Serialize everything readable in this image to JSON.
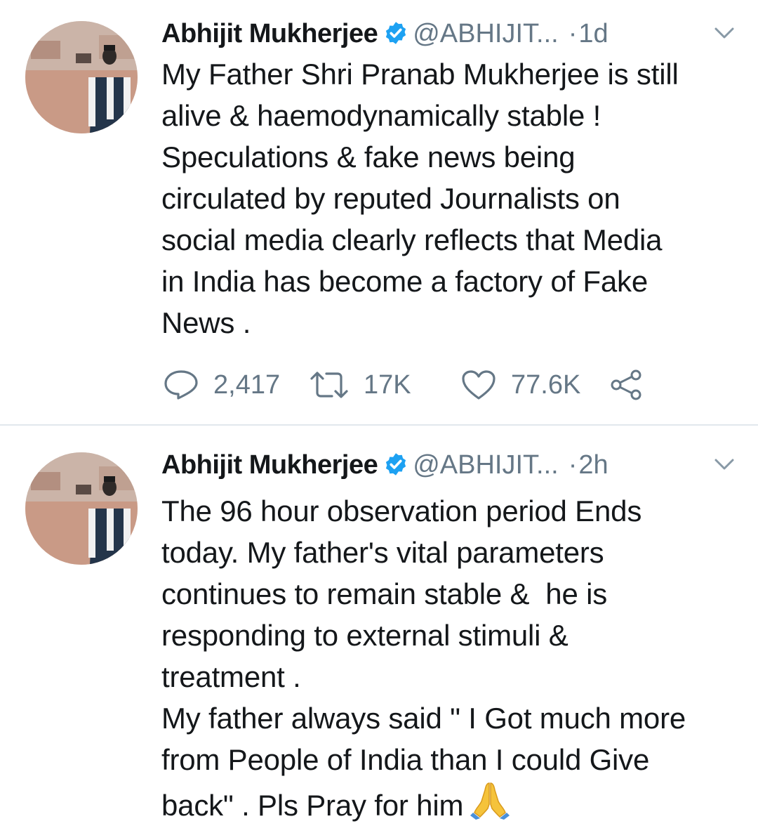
{
  "tweets": [
    {
      "author": {
        "display_name": "Abhijit Mukherjee",
        "handle": "@ABHIJIT...",
        "verified": true
      },
      "time": "1d",
      "text": "My Father Shri Pranab Mukherjee is still\nalive & haemodynamically stable !\nSpeculations & fake news being\ncirculated by reputed Journalists on\nsocial media clearly reflects that Media\nin India has become a factory of Fake\nNews .",
      "stats": {
        "replies": "2,417",
        "retweets": "17K",
        "likes": "77.6K"
      }
    },
    {
      "author": {
        "display_name": "Abhijit Mukherjee",
        "handle": "@ABHIJIT...",
        "verified": true
      },
      "time": "2h",
      "text": "The 96 hour observation period Ends\ntoday. My father's vital parameters\ncontinues to remain stable &  he is\nresponding to external stimuli &\ntreatment .\nMy father always said \" I Got much more\nfrom People of India than I could Give\nback\" . Pls Pray for him",
      "emoji": "folded-hands-emoji"
    }
  ],
  "separator": "·",
  "icons": {
    "verified": "verified-badge-icon",
    "menu": "chevron-down-icon",
    "reply": "reply-icon",
    "retweet": "retweet-icon",
    "like": "heart-icon",
    "share": "share-icon"
  },
  "colors": {
    "text": "#14171a",
    "secondary": "#657786",
    "verified_blue": "#1da1f2",
    "divider": "#e1e8ed"
  }
}
